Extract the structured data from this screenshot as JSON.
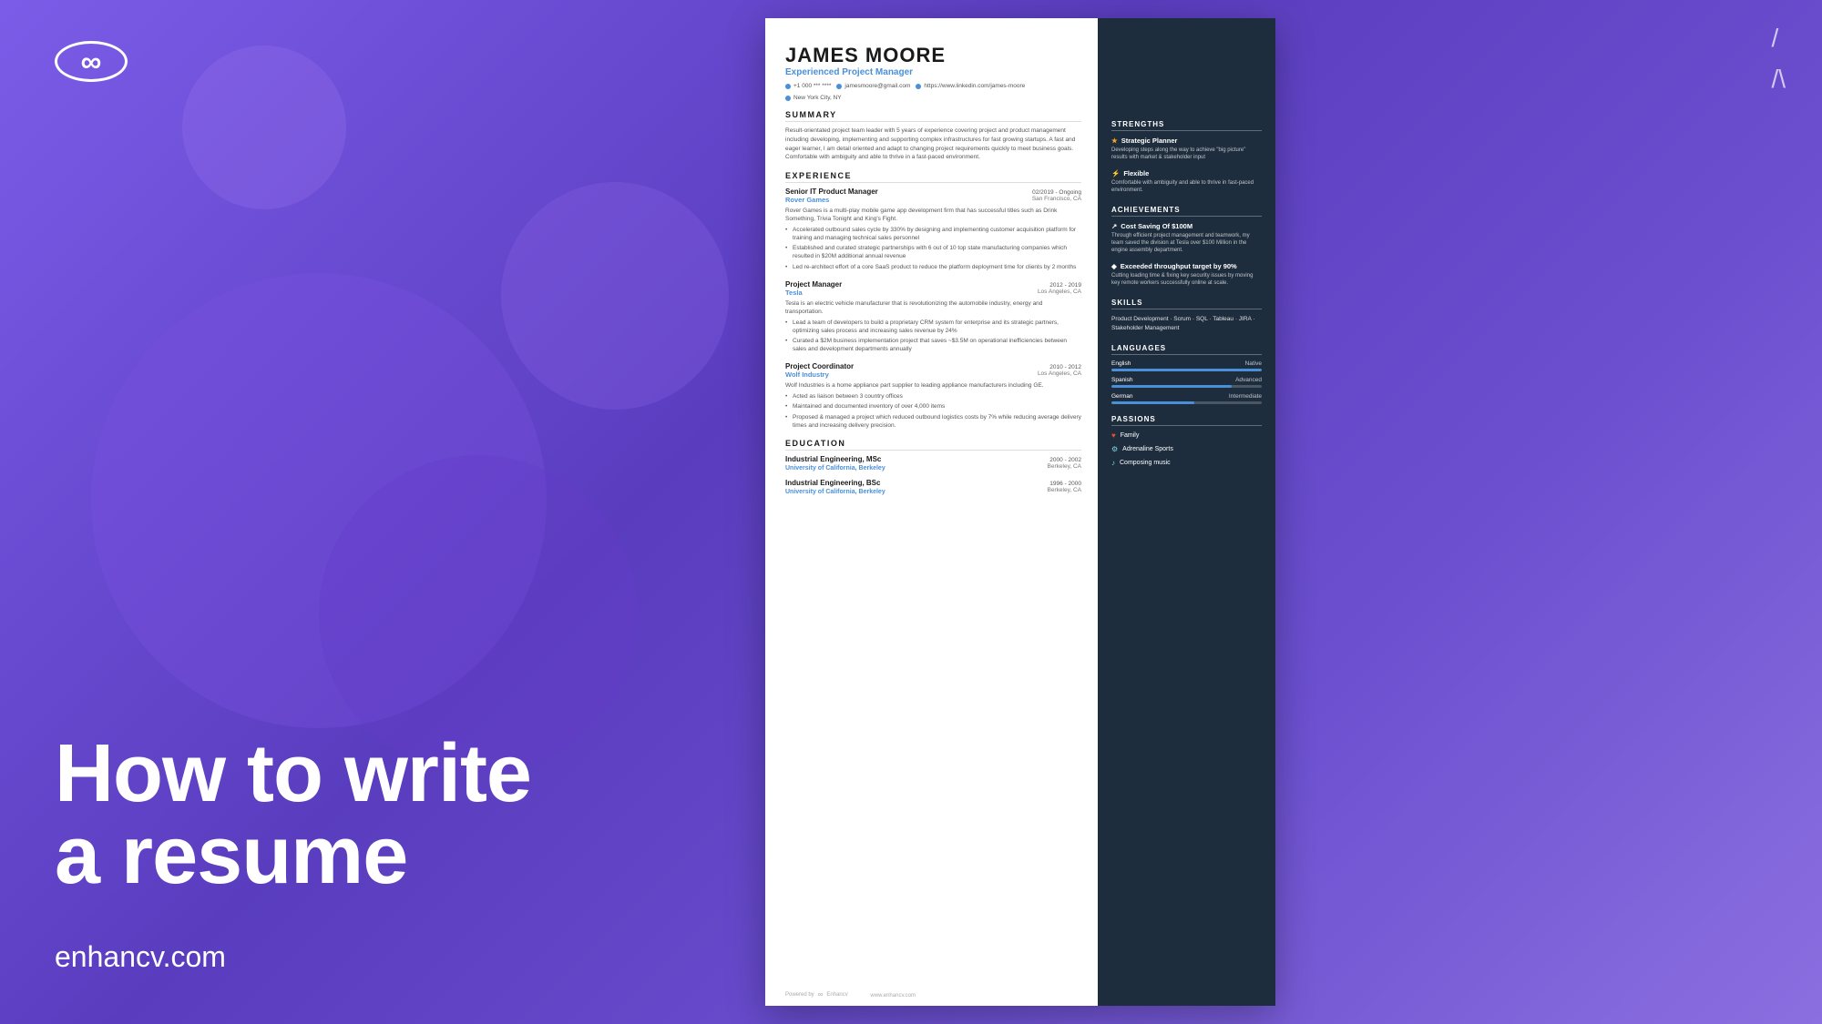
{
  "background": {
    "color": "#6b4fcf"
  },
  "logo": {
    "symbol": "∞",
    "website": "enhancv.com"
  },
  "headline": {
    "line1": "How to write",
    "line2": "a resume"
  },
  "deco_lines": "/ \n/\\ ",
  "resume": {
    "name": "JAMES MOORE",
    "title": "Experienced Project Manager",
    "contact": {
      "phone": "+1 000 *** ****",
      "email": "jamesmoore@gmail.com",
      "linkedin": "https://www.linkedin.com/james-moore",
      "location": "New York City, NY"
    },
    "summary": {
      "title": "SUMMARY",
      "text": "Result-orientated project team leader with 5 years of experience covering project and product management including developing, implementing and supporting complex infrastructures for fast growing startups. A fast and eager learner, I am detail oriented and adapt to changing project requirements quickly to meet business goals. Comfortable with ambiguity and able to thrive in a fast-paced environment."
    },
    "experience": {
      "title": "EXPERIENCE",
      "items": [
        {
          "role": "Senior IT Product Manager",
          "date": "02/2019 - Ongoing",
          "company": "Rover Games",
          "location": "San Francisco, CA",
          "description": "Rover Games is a multi-play mobile game app development firm that has successful titles such as Drink Something, Trivia Tonight and King's Fight.",
          "bullets": [
            "Accelerated outbound sales cycle by 330% by designing and implementing customer acquisition platform for training and managing technical sales personnel",
            "Established and curated strategic partnerships with 6 out of 10 top state manufacturing companies which resulted in $20M additional annual revenue",
            "Led re-architect effort of a core SaaS product to reduce the platform deployment time for clients by 2 months"
          ]
        },
        {
          "role": "Project Manager",
          "date": "2012 - 2019",
          "company": "Tesla",
          "location": "Los Angeles, CA",
          "description": "Tesla is an electric vehicle manufacturer that is revolutionizing the automobile industry, energy and transportation.",
          "bullets": [
            "Lead a team of developers to build a proprietary CRM system for enterprise and its strategic partners, optimizing sales process and increasing sales revenue by 24%",
            "Curated a $2M business implementation project that saves ~$3.5M on operational inefficiencies between sales and development departments annually"
          ]
        },
        {
          "role": "Project Coordinator",
          "date": "2010 - 2012",
          "company": "Wolf Industry",
          "location": "Los Angeles, CA",
          "description": "Wolf Industries is a home appliance part supplier to leading appliance manufacturers including GE.",
          "bullets": [
            "Acted as liaison between 3 country offices",
            "Maintained and documented inventory of over 4,000 items",
            "Proposed & managed a project which reduced outbound logistics costs by 7% while reducing average delivery times and increasing delivery precision."
          ]
        }
      ]
    },
    "education": {
      "title": "EDUCATION",
      "items": [
        {
          "degree": "Industrial Engineering, MSc",
          "school": "University of California, Berkeley",
          "date": "2000 - 2002",
          "location": "Berkeley, CA"
        },
        {
          "degree": "Industrial Engineering, BSc",
          "school": "University of California, Berkeley",
          "date": "1996 - 2000",
          "location": "Berkeley, CA"
        }
      ]
    },
    "powered_by": "Powered by",
    "watermark": "www.enhancv.com"
  },
  "sidebar": {
    "strengths": {
      "title": "STRENGTHS",
      "items": [
        {
          "icon": "★",
          "title": "Strategic Planner",
          "desc": "Developing steps along the way to achieve \"big picture\" results with market & stakeholder input"
        },
        {
          "icon": "⚡",
          "title": "Flexible",
          "desc": "Comfortable with ambiguity and able to thrive in fast-paced environment."
        }
      ]
    },
    "achievements": {
      "title": "ACHIEVEMENTS",
      "items": [
        {
          "icon": "↗",
          "title": "Cost Saving Of $100M",
          "desc": "Through efficient project management and teamwork, my team saved the division at Tesla over $100 Million in the engine assembly department."
        },
        {
          "icon": "◆",
          "title": "Exceeded throughput target by 90%",
          "desc": "Cutting loading time & fixing key security issues by moving key remote workers successfully online at scale."
        }
      ]
    },
    "skills": {
      "title": "SKILLS",
      "text": "Product Development · Scrum · SQL · Tableau · JIRA · Stakeholder Management"
    },
    "languages": {
      "title": "LANGUAGES",
      "items": [
        {
          "lang": "English",
          "level": "Native",
          "percent": 100
        },
        {
          "lang": "Spanish",
          "level": "Advanced",
          "percent": 80
        },
        {
          "lang": "German",
          "level": "Intermediate",
          "percent": 55
        }
      ]
    },
    "passions": {
      "title": "PASSIONS",
      "items": [
        {
          "icon": "♥",
          "label": "Family"
        },
        {
          "icon": "⚙",
          "label": "Adrenaline Sports"
        },
        {
          "icon": "♪",
          "label": "Composing music"
        }
      ]
    }
  }
}
